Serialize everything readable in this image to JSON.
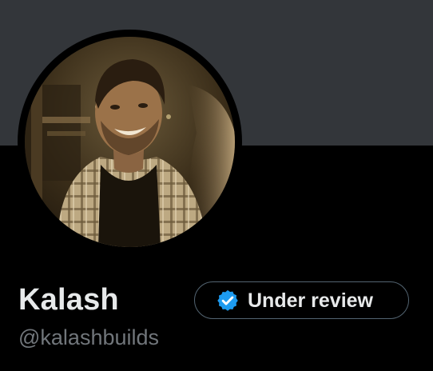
{
  "profile": {
    "display_name": "Kalash",
    "handle": "@kalashbuilds",
    "status_button_label": "Under review",
    "status_icon": "verified-badge-icon"
  },
  "colors": {
    "banner": "#33363a",
    "background": "#000000",
    "name_text": "#e7e9ea",
    "handle_text": "#71767b",
    "pill_border": "#536471",
    "verified_blue": "#1d9bf0"
  }
}
